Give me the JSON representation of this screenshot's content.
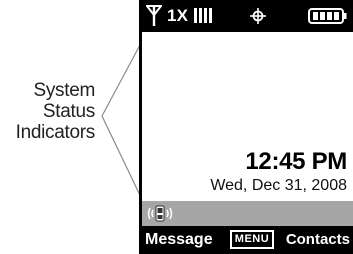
{
  "callout": {
    "lines": [
      "System",
      "Status",
      "Indicators"
    ]
  },
  "status_bar": {
    "signal_icon": "antenna-icon",
    "network": "1X",
    "signal_bars_icon": "signal-strength-icon",
    "gps_icon": "gps-icon",
    "battery_icon": "battery-icon"
  },
  "home": {
    "time": "12:45 PM",
    "date": "Wed, Dec 31, 2008"
  },
  "indicators": {
    "vibrate_icon": "vibrate-icon"
  },
  "soft_keys": {
    "left": "Message",
    "center": "MENU",
    "right": "Contacts"
  },
  "colors": {
    "bar": "#000000",
    "strip": "#a6a6a6",
    "screen": "#ffffff",
    "callout_line": "#888888"
  }
}
